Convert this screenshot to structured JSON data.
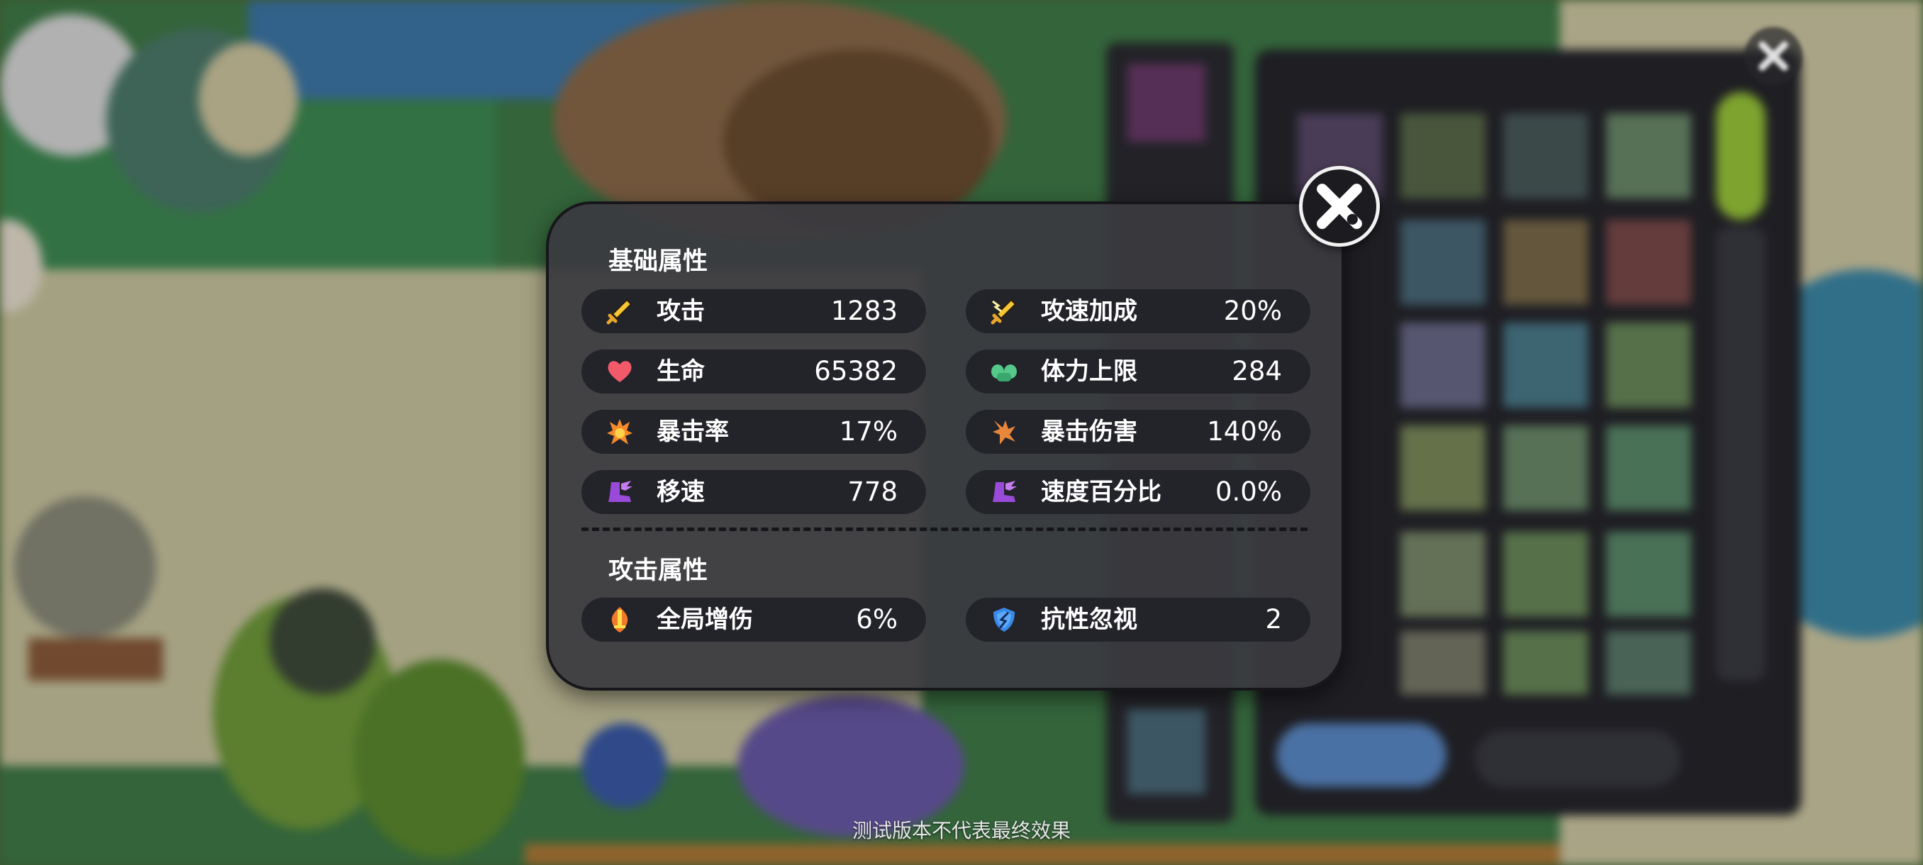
{
  "panel": {
    "basic_title": "基础属性",
    "attack_title": "攻击属性",
    "basic_stats": [
      {
        "label": "攻击",
        "value": "1283",
        "icon": "sword-icon"
      },
      {
        "label": "攻速加成",
        "value": "20%",
        "icon": "lightning-sword-icon"
      },
      {
        "label": "生命",
        "value": "65382",
        "icon": "heart-icon"
      },
      {
        "label": "体力上限",
        "value": "284",
        "icon": "muscle-icon"
      },
      {
        "label": "暴击率",
        "value": "17%",
        "icon": "fire-burst-icon"
      },
      {
        "label": "暴击伤害",
        "value": "140%",
        "icon": "crit-burst-icon"
      },
      {
        "label": "移速",
        "value": "778",
        "icon": "winged-boot-icon"
      },
      {
        "label": "速度百分比",
        "value": "0.0%",
        "icon": "winged-boot-icon"
      }
    ],
    "attack_stats": [
      {
        "label": "全局增伤",
        "value": "6%",
        "icon": "flame-sword-icon"
      },
      {
        "label": "抗性忽视",
        "value": "2",
        "icon": "broken-shield-icon"
      }
    ]
  },
  "disclaimer": "测试版本不代表最终效果",
  "colors": {
    "panel_bg": "#3a3a40",
    "row_bg": "#23232a",
    "text": "#ffffff"
  }
}
